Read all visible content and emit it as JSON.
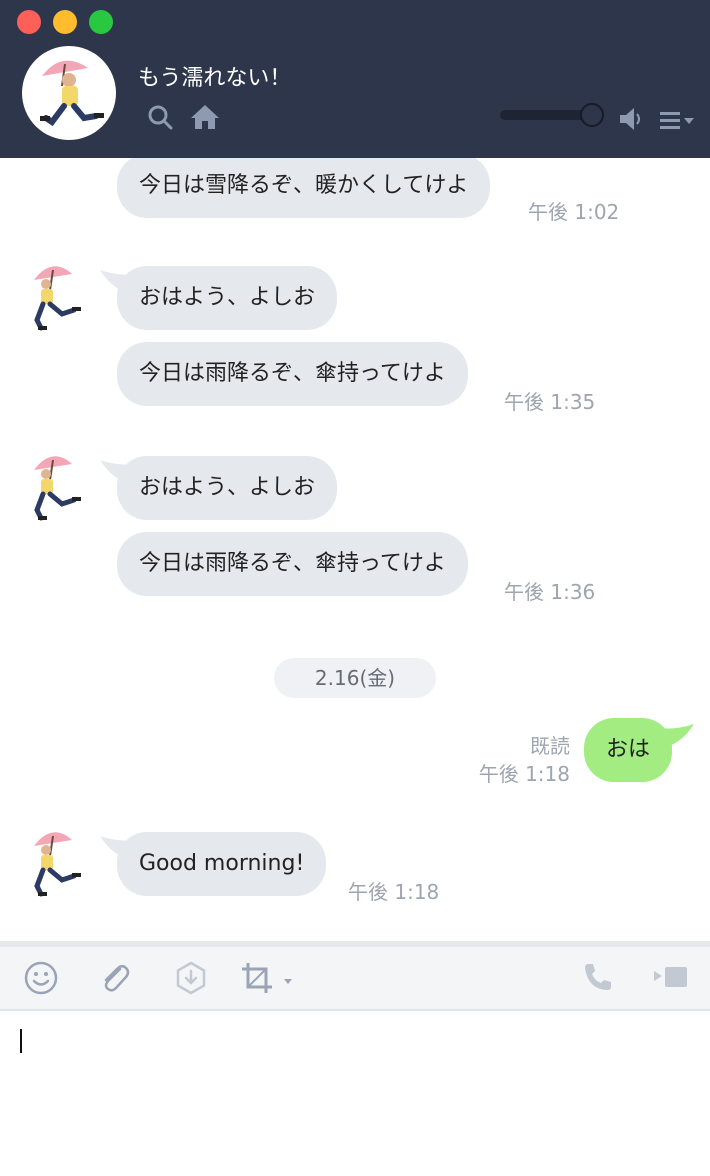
{
  "header": {
    "title": "もう濡れない！",
    "volume_level": 0.9
  },
  "messages": [
    {
      "text": "今日は雪降るぞ、暖かくしてけよ",
      "time": "午後 1:02"
    },
    {
      "text": "おはよう、よしお"
    },
    {
      "text": "今日は雨降るぞ、傘持ってけよ",
      "time": "午後 1:35"
    },
    {
      "text": "おはよう、よしお"
    },
    {
      "text": "今日は雨降るぞ、傘持ってけよ",
      "time": "午後 1:36"
    }
  ],
  "date_separator": "2.16(金)",
  "my_message": {
    "text": "おは",
    "read": "既読",
    "time": "午後 1:18"
  },
  "last_message": {
    "text": "Good morning!",
    "time": "午後 1:18"
  },
  "colors": {
    "header_bg": "#2d364a",
    "incoming_bubble": "#e5e9ee",
    "outgoing_bubble": "#a3ec82"
  },
  "toolbar_icons": [
    "smiley-icon",
    "paperclip-icon",
    "download-icon",
    "crop-icon",
    "phone-icon",
    "video-icon"
  ]
}
